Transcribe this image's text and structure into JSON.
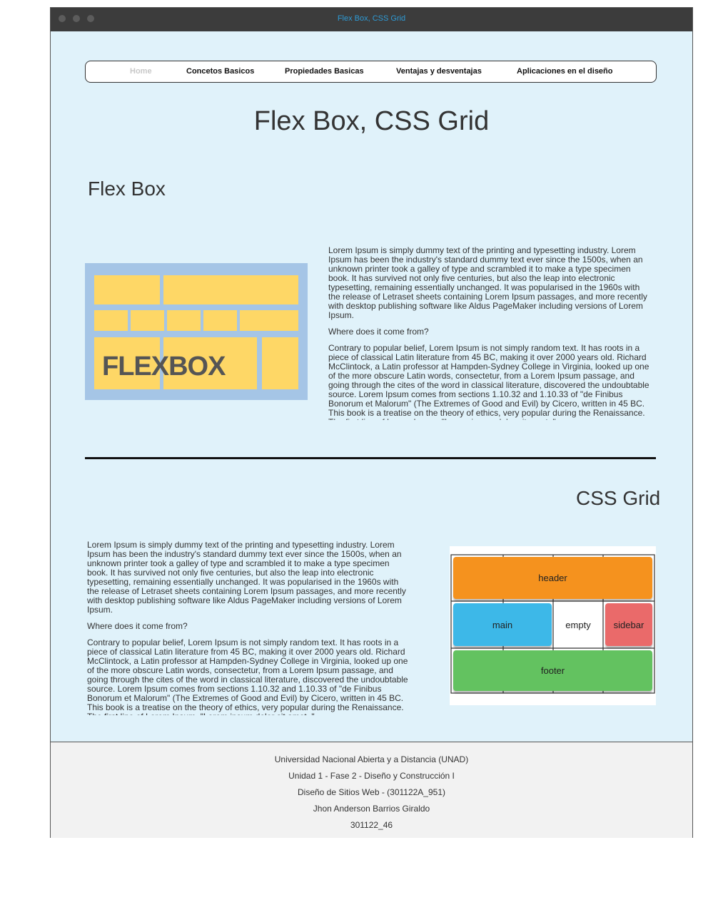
{
  "window": {
    "title": "Flex Box, CSS Grid"
  },
  "nav": {
    "items": [
      "Home",
      "Concetos Basicos",
      "Propiedades Basicas",
      "Ventajas y desventajas",
      "Aplicaciones en el diseño"
    ]
  },
  "page": {
    "title": "Flex Box, CSS Grid"
  },
  "flexbox": {
    "heading": "Flex Box",
    "image_text": "FLEXBOX",
    "para1": "Lorem Ipsum is simply dummy text of the printing and typesetting industry. Lorem Ipsum has been the industry's standard dummy text ever since the 1500s, when an unknown printer took a galley of type and scrambled it to make a type specimen book. It has survived not only five centuries, but also the leap into electronic typesetting, remaining essentially unchanged. It was popularised in the 1960s with the release of Letraset sheets containing Lorem Ipsum passages, and more recently with desktop publishing software like Aldus PageMaker including versions of Lorem Ipsum.",
    "question": "Where does it come from?",
    "para2": "Contrary to popular belief, Lorem Ipsum is not simply random text. It has roots in a piece of classical Latin literature from 45 BC, making it over 2000 years old. Richard McClintock, a Latin professor at Hampden-Sydney College in Virginia, looked up one of the more obscure Latin words, consectetur, from a Lorem Ipsum passage, and going through the cites of the word in classical literature, discovered the undoubtable source. Lorem Ipsum comes from sections 1.10.32 and 1.10.33 of \"de Finibus Bonorum et Malorum\" (The Extremes of Good and Evil) by Cicero, written in 45 BC. This book is a treatise on the theory of ethics, very popular during the Renaissance. The first line of Lorem Ipsum, \"Lorem ipsum dolor sit amet..\""
  },
  "cssgrid": {
    "heading": "CSS Grid",
    "cells": {
      "header": "header",
      "main": "main",
      "empty": "empty",
      "sidebar": "sidebar",
      "footer": "footer"
    },
    "para1": "Lorem Ipsum is simply dummy text of the printing and typesetting industry. Lorem Ipsum has been the industry's standard dummy text ever since the 1500s, when an unknown printer took a galley of type and scrambled it to make a type specimen book. It has survived not only five centuries, but also the leap into electronic typesetting, remaining essentially unchanged. It was popularised in the 1960s with the release of Letraset sheets containing Lorem Ipsum passages, and more recently with desktop publishing software like Aldus PageMaker including versions of Lorem Ipsum.",
    "question": "Where does it come from?",
    "para2": "Contrary to popular belief, Lorem Ipsum is not simply random text. It has roots in a piece of classical Latin literature from 45 BC, making it over 2000 years old. Richard McClintock, a Latin professor at Hampden-Sydney College in Virginia, looked up one of the more obscure Latin words, consectetur, from a Lorem Ipsum passage, and going through the cites of the word in classical literature, discovered the undoubtable source. Lorem Ipsum comes from sections 1.10.32 and 1.10.33 of \"de Finibus Bonorum et Malorum\" (The Extremes of Good and Evil) by Cicero, written in 45 BC. This book is a treatise on the theory of ethics, very popular during the Renaissance. The first line of Lorem Ipsum, \"Lorem ipsum dolor sit amet..\""
  },
  "footer": {
    "lines": [
      "Universidad Nacional Abierta y a Distancia (UNAD)",
      "Unidad 1 - Fase 2 - Diseño y Construcción I",
      "Diseño de Sitios Web - (301122A_951)",
      "Jhon Anderson Barrios Giraldo",
      "301122_46"
    ]
  },
  "colors": {
    "background": "#e0f2fa",
    "titlebar": "#3c3c3c",
    "title_text": "#2e9bd6",
    "flex_yellow": "#fed766",
    "flex_blue": "#a5c5e6",
    "grid_header": "#f5921e",
    "grid_main": "#3db8e8",
    "grid_sidebar": "#ea6a6a",
    "grid_footer": "#63c260"
  }
}
